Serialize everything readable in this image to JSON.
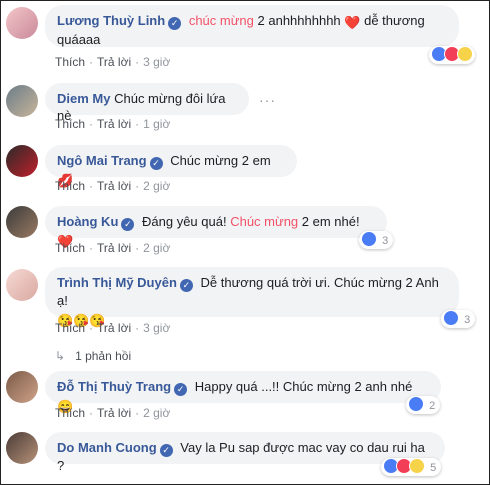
{
  "comments": [
    {
      "author": "Lương Thuỳ Linh",
      "verified": true,
      "text_before": "",
      "highlight": "chúc mừng",
      "text_after": " 2 anhhhhhhhh",
      "line2": "dễ thương quáaaa",
      "emoji_mid": "❤️",
      "actions": {
        "like": "Thích",
        "reply": "Trả lời",
        "time": "3 giờ"
      },
      "reaction_count": ""
    },
    {
      "author": "Diem My",
      "verified": false,
      "text": "Chúc mừng đôi lứa nè",
      "actions": {
        "like": "Thích",
        "reply": "Trả lời",
        "time": "1 giờ"
      },
      "more": "···"
    },
    {
      "author": "Ngô Mai Trang",
      "verified": true,
      "text": "Chúc mừng 2 em",
      "emoji": "💋",
      "actions": {
        "like": "Thích",
        "reply": "Trả lời",
        "time": "2 giờ"
      }
    },
    {
      "author": "Hoàng Ku",
      "verified": true,
      "text_before": "Đáng yêu quá! ",
      "highlight": "Chúc mừng",
      "text_after": " 2 em nhé!",
      "emoji": "❤️",
      "actions": {
        "like": "Thích",
        "reply": "Trả lời",
        "time": "2 giờ"
      },
      "reaction_count": "3"
    },
    {
      "author": "Trình Thị Mỹ Duyên",
      "verified": true,
      "text": "Dễ thương quá trời ưi. Chúc mừng 2 Anh ạ!",
      "emoji_line": "😘😘😘",
      "actions": {
        "like": "Thích",
        "reply": "Trả lời",
        "time": "3 giờ"
      },
      "reaction_count": "3",
      "replies": "1 phản hồi"
    },
    {
      "author": "Đỗ Thị Thuỳ Trang",
      "verified": true,
      "text": "Happy quá ...!! Chúc mừng 2 anh nhé",
      "emoji": "😄",
      "actions": {
        "like": "Thích",
        "reply": "Trả lời",
        "time": "2 giờ"
      },
      "reaction_count": "2"
    },
    {
      "author": "Do Manh Cuong",
      "verified": true,
      "text": "Vay la Pu sap được mac vay co dau rui ha ?",
      "reaction_count": "5"
    }
  ],
  "colors": {
    "author": "#385898",
    "highlight": "#f25268",
    "bubble": "#f2f3f5",
    "like": "#4a7cf6",
    "love": "#f33e58"
  }
}
